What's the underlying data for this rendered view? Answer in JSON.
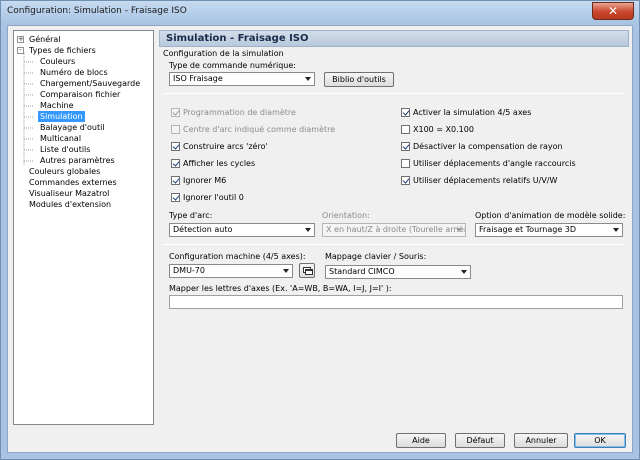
{
  "window": {
    "title": "Configuration: Simulation - Fraisage ISO",
    "close_label": "✕"
  },
  "tree": {
    "items": [
      {
        "label": "Général",
        "expander": "+"
      },
      {
        "label": "Types de fichiers",
        "expander": "-"
      },
      {
        "label": "Couleurs"
      },
      {
        "label": "Numéro de blocs"
      },
      {
        "label": "Chargement/Sauvegarde"
      },
      {
        "label": "Comparaison fichier"
      },
      {
        "label": "Machine"
      },
      {
        "label": "Simulation",
        "selected": true
      },
      {
        "label": "Balayage d'outil"
      },
      {
        "label": "Multicanal"
      },
      {
        "label": "Liste d'outils"
      },
      {
        "label": "Autres paramètres"
      },
      {
        "label": "Couleurs globales"
      },
      {
        "label": "Commandes externes"
      },
      {
        "label": "Visualiseur Mazatrol"
      },
      {
        "label": "Modules d'extension"
      }
    ]
  },
  "pane": {
    "header": "Simulation - Fraisage ISO",
    "group_label": "Configuration de la simulation",
    "command_type_label": "Type de commande numérique:",
    "command_type_value": "ISO Fraisage",
    "tool_library_button": "Biblio d'outils",
    "left_checks": [
      {
        "label": "Programmation de diamètre",
        "checked": true,
        "disabled": true
      },
      {
        "label": "Centre d'arc indiqué comme diamètre",
        "checked": false,
        "disabled": true
      },
      {
        "label": "Construire arcs 'zéro'",
        "checked": true,
        "disabled": false
      },
      {
        "label": "Afficher les cycles",
        "checked": true,
        "disabled": false
      },
      {
        "label": "Ignorer M6",
        "checked": true,
        "disabled": false
      },
      {
        "label": "Ignorer l'outil 0",
        "checked": true,
        "disabled": false
      }
    ],
    "right_checks": [
      {
        "label": "Activer la simulation 4/5 axes",
        "checked": true
      },
      {
        "label": "X100 = X0.100",
        "checked": false
      },
      {
        "label": "Désactiver la compensation de rayon",
        "checked": true
      },
      {
        "label": "Utiliser déplacements d'angle raccourcis",
        "checked": false
      },
      {
        "label": "Utiliser déplacements relatifs U/V/W",
        "checked": true
      }
    ],
    "arc_type_label": "Type d'arc:",
    "arc_type_value": "Détection auto",
    "orientation_label": "Orientation:",
    "orientation_value": "X en haut/Z à droite (Tourelle arrière)",
    "animation_label": "Option d'animation de modèle solide:",
    "animation_value": "Fraisage et Tournage 3D",
    "machine_config_label": "Configuration machine (4/5 axes):",
    "machine_config_value": "DMU-70",
    "keyboard_mapping_label": "Mappage clavier / Souris:",
    "keyboard_mapping_value": "Standard CIMCO",
    "axis_letters_label": "Mapper les lettres d'axes (Ex. 'A=WB, B=WA, I=J, J=I' ):",
    "axis_letters_value": ""
  },
  "buttons": {
    "help": "Aide",
    "default": "Défaut",
    "cancel": "Annuler",
    "ok": "OK"
  }
}
